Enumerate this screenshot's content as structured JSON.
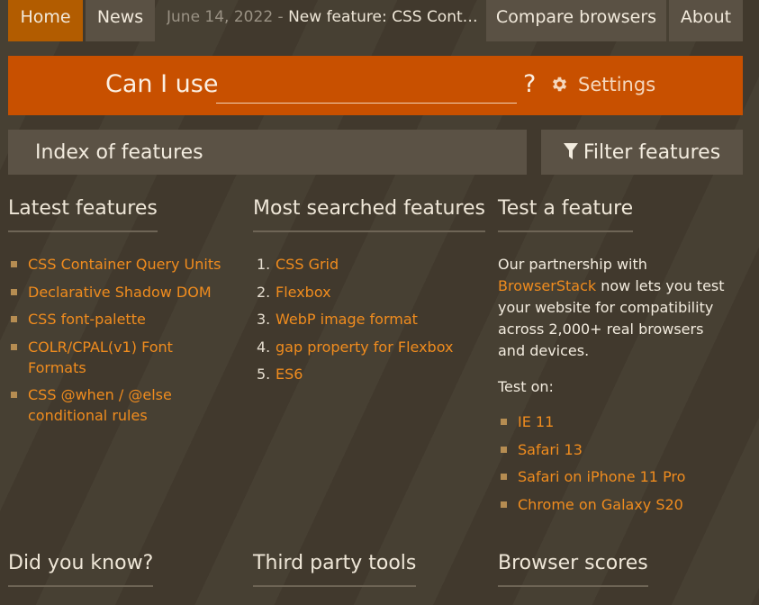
{
  "nav": {
    "home": "Home",
    "news": "News",
    "announcement_date": "June 14, 2022",
    "announcement_sep": " - ",
    "announcement_title": "New feature: CSS Container Query Units",
    "compare": "Compare browsers",
    "about": "About"
  },
  "search": {
    "label": "Can I use",
    "value": "",
    "qmark": "?",
    "settings": "Settings"
  },
  "index": {
    "title": "Index of features",
    "filter": "Filter features"
  },
  "latest": {
    "title": "Latest features",
    "items": [
      "CSS Container Query Units",
      "Declarative Shadow DOM",
      "CSS font-palette",
      "COLR/CPAL(v1) Font Formats",
      "CSS @when / @else conditional rules"
    ]
  },
  "most_searched": {
    "title": "Most searched features",
    "items": [
      {
        "num": "1.",
        "label": "CSS Grid"
      },
      {
        "num": "2.",
        "label": "Flexbox"
      },
      {
        "num": "3.",
        "label": "WebP image format"
      },
      {
        "num": "4.",
        "label": "gap property for Flexbox"
      },
      {
        "num": "5.",
        "label": "ES6"
      }
    ]
  },
  "test": {
    "title": "Test a feature",
    "intro_before": "Our partnership with",
    "partner": "BrowserStack",
    "intro_after": "now lets you test your website for compatibility across 2,000+ real browsers and devices.",
    "test_on": "Test on:",
    "items": [
      "IE 11",
      "Safari 13",
      "Safari on iPhone 11 Pro",
      "Chrome on Galaxy S20"
    ]
  },
  "bottom": {
    "did_you_know": "Did you know?",
    "third_party": "Third party tools",
    "browser_scores": "Browser scores"
  },
  "colors": {
    "accent": "#c85000",
    "link": "#f08c1e",
    "background": "#433b2e",
    "panel": "#5b5245"
  },
  "icons": {
    "settings": "gear-icon",
    "filter": "filter-icon"
  }
}
